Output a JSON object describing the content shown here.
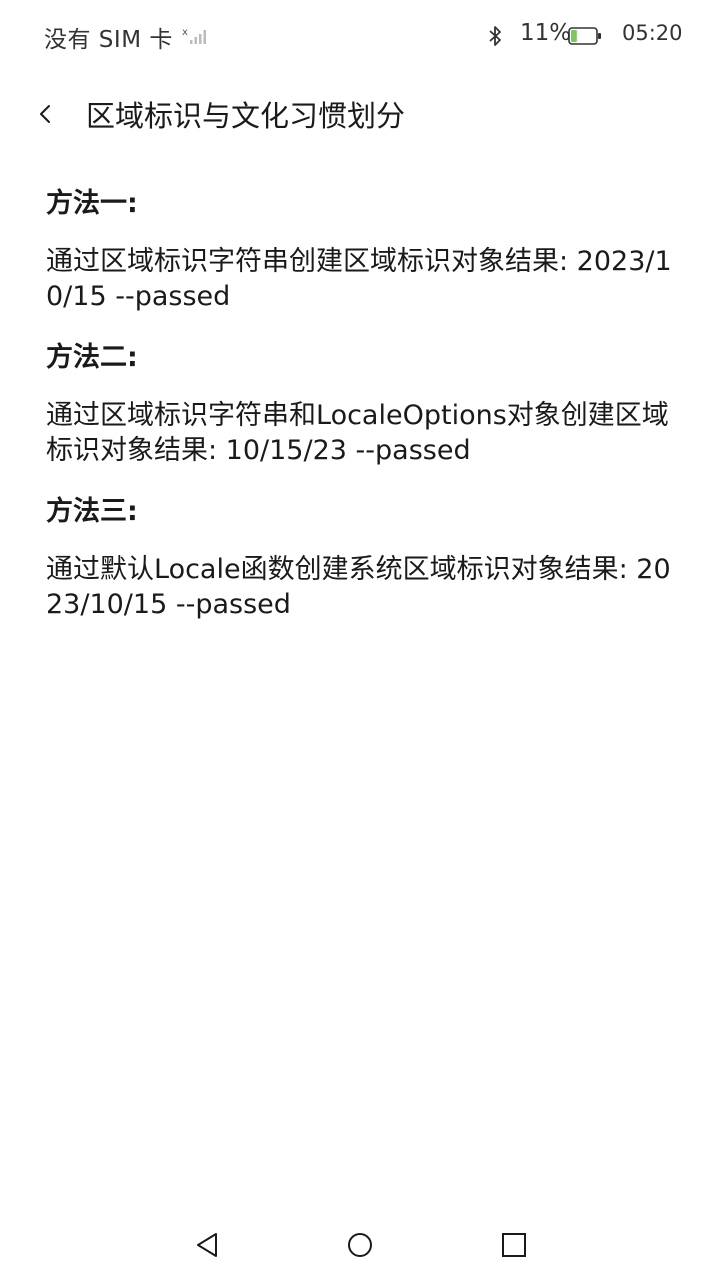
{
  "status_bar": {
    "carrier": "没有 SIM 卡",
    "battery_percent": "11%",
    "battery_level": 0.11,
    "time": "05:20",
    "icons": [
      "signal-icon",
      "bluetooth-icon",
      "battery-icon"
    ],
    "battery_color": "#7cc85a"
  },
  "header": {
    "title": "区域标识与文化习惯划分",
    "back_icon": "chevron-left-icon"
  },
  "sections": [
    {
      "heading": "方法一:",
      "body": "通过区域标识字符串创建区域标识对象结果: 2023/10/15 --passed"
    },
    {
      "heading": "方法二:",
      "body": "通过区域标识字符串和LocaleOptions对象创建区域标识对象结果: 10/15/23 --passed"
    },
    {
      "heading": "方法三:",
      "body": "通过默认Locale函数创建系统区域标识对象结果: 2023/10/15 --passed"
    }
  ],
  "nav_bar": {
    "buttons": [
      "nav-back-icon",
      "nav-home-icon",
      "nav-recent-icon"
    ]
  }
}
